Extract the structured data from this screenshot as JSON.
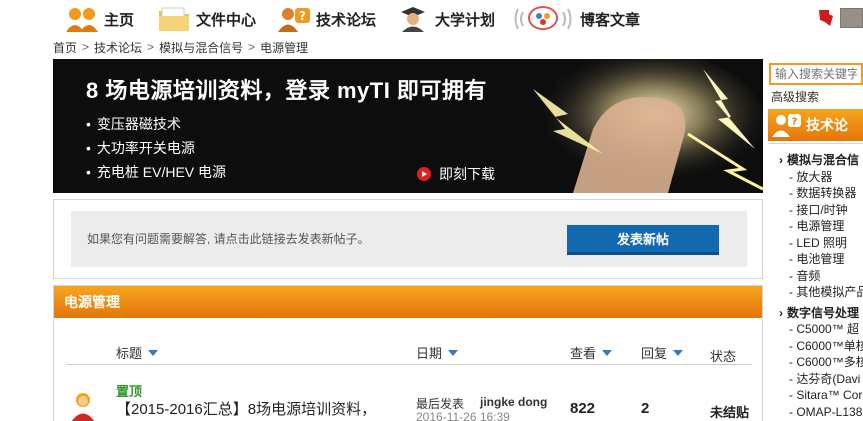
{
  "nav": {
    "items": [
      {
        "label": "主页",
        "icon": "people-home-icon"
      },
      {
        "label": "文件中心",
        "icon": "folder-icon"
      },
      {
        "label": "技术论坛",
        "icon": "forum-question-icon"
      },
      {
        "label": "大学计划",
        "icon": "graduate-icon"
      },
      {
        "label": "博客文章",
        "icon": "blog-chat-icon"
      }
    ]
  },
  "breadcrumb": [
    "首页",
    "技术论坛",
    "模拟与混合信号",
    "电源管理"
  ],
  "banner": {
    "title": "8 场电源培训资料，登录 myTI 即可拥有",
    "bullets": [
      "变压器磁技术",
      "大功率开关电源",
      "充电桩 EV/HEV 电源"
    ],
    "download": "即刻下载"
  },
  "post": {
    "hint": "如果您有问题需要解答, 请点击此链接去发表新帖子。",
    "button": "发表新帖"
  },
  "forum": {
    "title": "电源管理",
    "columns": {
      "subject": "标题",
      "date": "日期",
      "views": "查看",
      "replies": "回复",
      "status": "状态"
    },
    "thread": {
      "pinned": "置顶",
      "title": "【2015-2016汇总】8场电源培训资料，",
      "last_label": "最后发表",
      "last_user": "jingke dong",
      "last_date": "2016-11-26 16:39",
      "views": "822",
      "replies": "2",
      "status": "未结贴"
    }
  },
  "sidebar": {
    "search_placeholder": "输入搜索关键字",
    "advanced": "高级搜索",
    "tab": "技术论",
    "categories": [
      {
        "name": "模拟与混合信",
        "subs": [
          "放大器",
          "数据转换器",
          "接口/时钟",
          "电源管理",
          "LED 照明",
          "电池管理",
          "音频",
          "其他模拟产品"
        ]
      },
      {
        "name": "数字信号处理",
        "subs": [
          "C5000™ 超",
          "C6000™单核",
          "C6000™多核",
          "达芬奇(Davi",
          "Sitara™ Cor",
          "OMAP-L138"
        ]
      }
    ]
  },
  "colors": {
    "accent_orange": "#f39b1f",
    "button_blue": "#1369b0",
    "pinned_green": "#2b9b2b"
  }
}
